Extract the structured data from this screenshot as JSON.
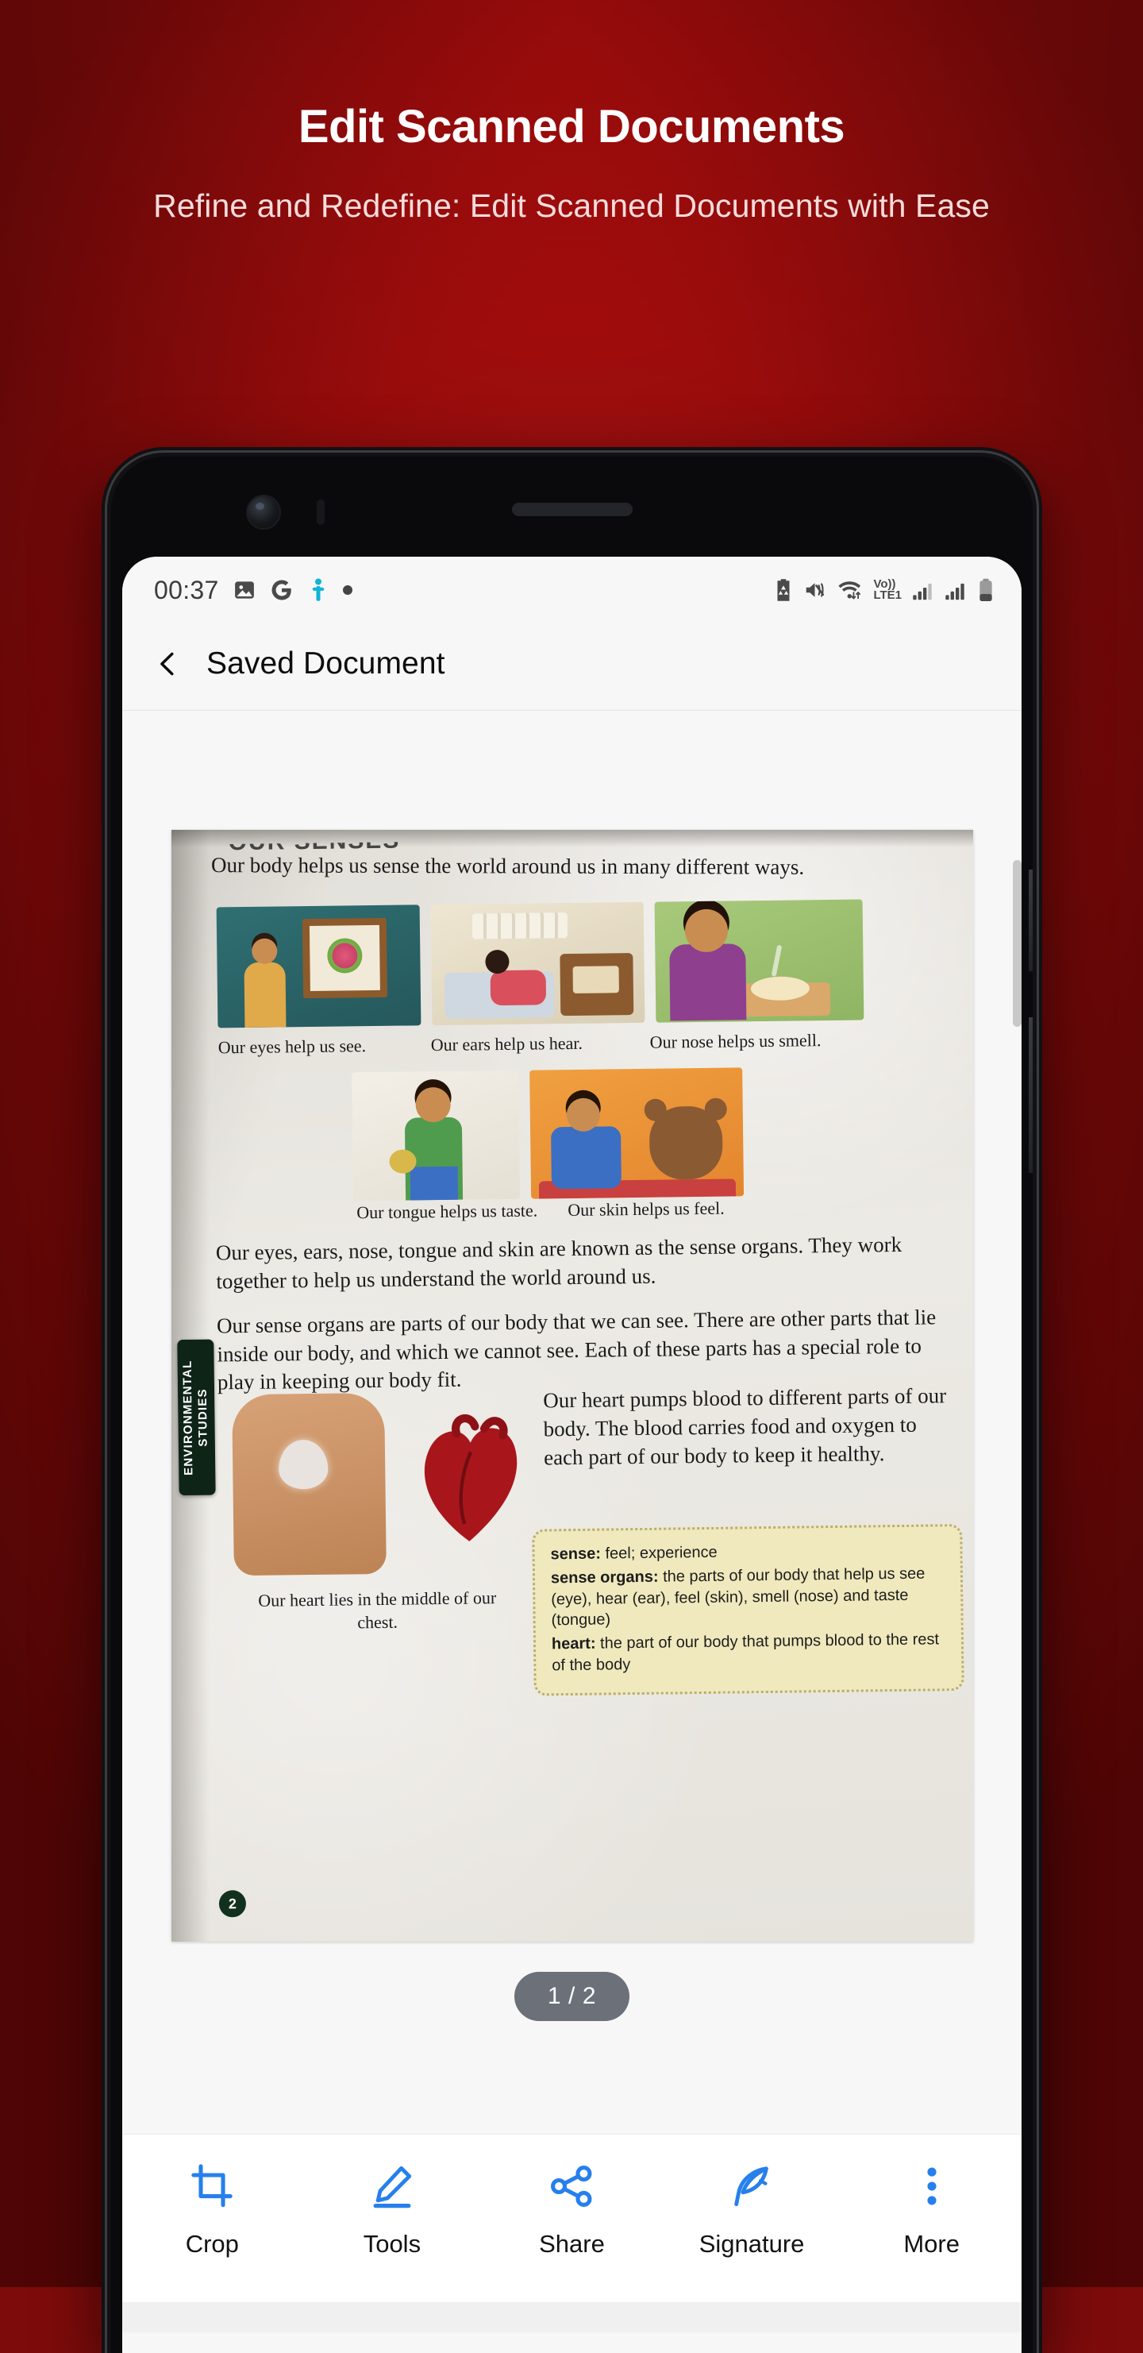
{
  "promo": {
    "headline": "Edit Scanned Documents",
    "subheadline": "Refine and Redefine: Edit Scanned Documents with Ease",
    "background_color": "#8d0b0b",
    "headline_color": "#ffffff",
    "subheadline_color": "#f6dcdc"
  },
  "status_bar": {
    "time": "00:37",
    "left_icons": [
      "image-icon",
      "google-g-icon",
      "person-icon",
      "dot-icon"
    ],
    "person_icon_color": "#0fb5d6",
    "right_icons": [
      "battery-saver-icon",
      "mute-vibrate-icon",
      "wifi-data-icon",
      "volte-icon",
      "signal-sim1-icon",
      "signal-sim2-icon",
      "battery-icon"
    ],
    "network_label": "Vo)) LTE1",
    "network_label_top": "Vo))",
    "network_label_bottom": "LTE1"
  },
  "app_bar": {
    "back_icon": "chevron-left-icon",
    "title": "Saved Document"
  },
  "viewer": {
    "page_indicator": "1 / 2",
    "page_indicator_bg": "#6b7079"
  },
  "document": {
    "cut_heading": "OUR SENSES",
    "intro": "Our body helps us sense the world around us in many different ways.",
    "intro_highlight": "sense",
    "captions_row1": [
      "Our eyes help us see.",
      "Our ears help us hear.",
      "Our nose helps us smell."
    ],
    "captions_row2": [
      "Our tongue helps us taste.",
      "Our skin helps us feel."
    ],
    "paragraph1": "Our eyes, ears, nose, tongue and skin are known as the sense organs. They work together to help us understand the world around us.",
    "paragraph2": "Our sense organs are parts of our body that we can see. There are other parts that lie inside our body, and which we cannot see. Each of these parts has a special role to play in keeping our body fit.",
    "paragraph3": "Our heart pumps blood to different parts of our body. The blood carries food and oxygen to each part of our body to keep it healthy.",
    "heart_caption": "Our heart lies in the middle of our chest.",
    "side_tab_label": "ENVIRONMENTAL STUDIES",
    "page_number": "2",
    "glossary": [
      {
        "term": "sense:",
        "definition": " feel; experience"
      },
      {
        "term": "sense organs:",
        "definition": " the parts of our body that help us see (eye), hear (ear), feel (skin), smell (nose) and taste (tongue)"
      },
      {
        "term": "heart:",
        "definition": " the part of our body that pumps blood to the rest of the body"
      }
    ],
    "glossary_bg": "#efe9bd"
  },
  "toolbar": {
    "accent_color": "#2680eb",
    "items": [
      {
        "label": "Crop",
        "icon": "crop-icon"
      },
      {
        "label": "Tools",
        "icon": "pencil-icon"
      },
      {
        "label": "Share",
        "icon": "share-icon"
      },
      {
        "label": "Signature",
        "icon": "feather-icon"
      },
      {
        "label": "More",
        "icon": "more-vertical-icon"
      }
    ]
  }
}
